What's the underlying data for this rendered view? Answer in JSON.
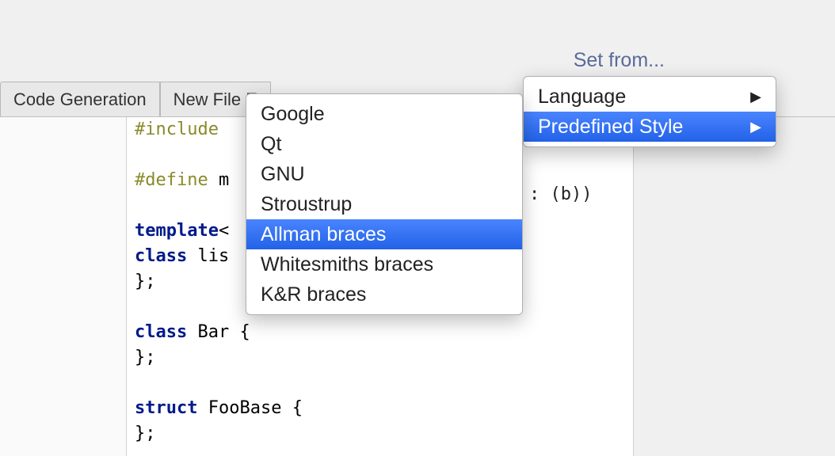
{
  "tabs": {
    "code_generation": "Code Generation",
    "new_file": "New File E"
  },
  "set_from": {
    "label": "Set from...",
    "items": {
      "language": "Language",
      "predefined_style": "Predefined Style"
    }
  },
  "style_submenu": {
    "items": [
      {
        "label": "Google"
      },
      {
        "label": "Qt"
      },
      {
        "label": "GNU"
      },
      {
        "label": "Stroustrup"
      },
      {
        "label": "Allman braces"
      },
      {
        "label": "Whitesmiths braces"
      },
      {
        "label": "K&R braces"
      }
    ]
  },
  "code": {
    "include_directive": "#include ",
    "define_directive": "#define ",
    "define_name_partial": "m",
    "template_keyword": "template",
    "class_keyword": "class",
    "struct_keyword": "struct",
    "angle_partial": "<",
    "class_lis_partial": " lis",
    "close_brace_semi": "};",
    "bar_name": " Bar {",
    "foobase_name": " FooBase {",
    "right_fragment": ": (b))"
  }
}
